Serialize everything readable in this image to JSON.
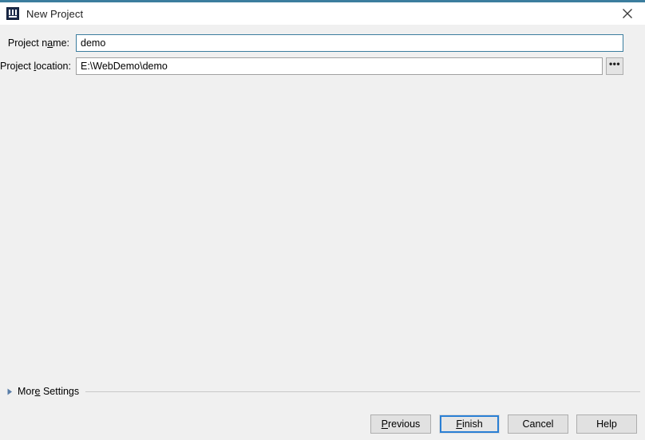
{
  "window": {
    "title": "New Project",
    "icon": "intellij-idea-icon",
    "accent_color": "#3b7d9e",
    "close_label": "✕"
  },
  "form": {
    "fields": [
      {
        "label_before": "Project n",
        "label_mnemonic": "a",
        "label_after": "me:",
        "value": "demo",
        "name": "project-name"
      },
      {
        "label_before": "Project ",
        "label_mnemonic": "l",
        "label_after": "ocation:",
        "value": "E:\\WebDemo\\demo",
        "name": "project-location"
      }
    ],
    "browse_label": "•••"
  },
  "more_settings": {
    "label_before": "Mor",
    "label_mnemonic": "e",
    "label_after": " Settings",
    "expander": "collapsed-triangle-icon"
  },
  "buttons": [
    {
      "before": "",
      "mnemonic": "P",
      "after": "revious",
      "name": "previous-button",
      "default": false
    },
    {
      "before": "",
      "mnemonic": "F",
      "after": "inish",
      "name": "finish-button",
      "default": true
    },
    {
      "before": "Cancel",
      "mnemonic": "",
      "after": "",
      "name": "cancel-button",
      "default": false
    },
    {
      "before": "Help",
      "mnemonic": "",
      "after": "",
      "name": "help-button",
      "default": false
    }
  ]
}
